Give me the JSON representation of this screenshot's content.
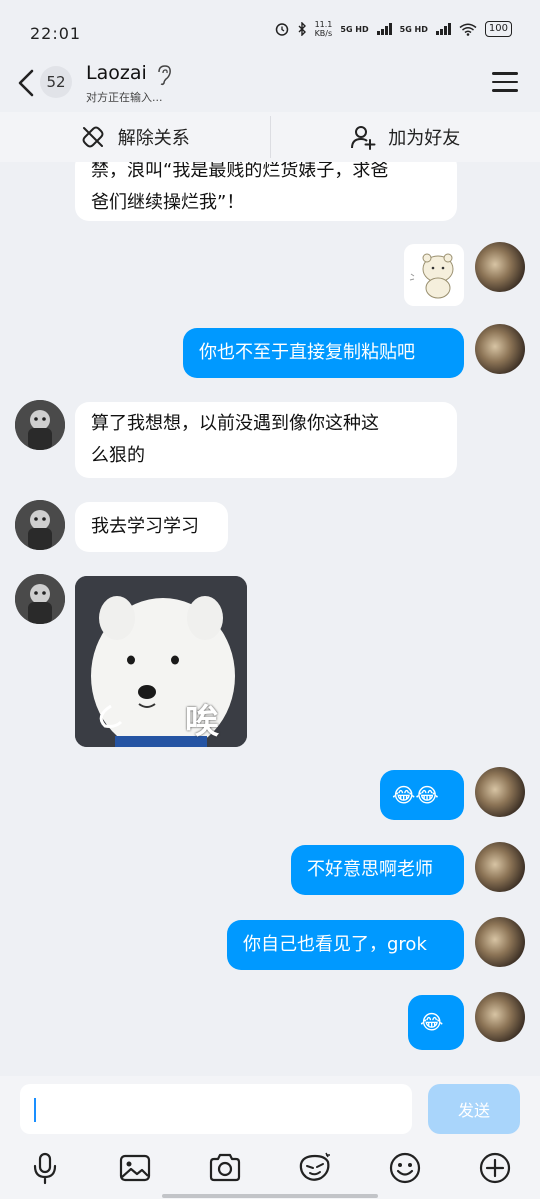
{
  "status_bar": {
    "time": "22:01",
    "net_speed_value": "11.1",
    "net_speed_unit": "KB/s",
    "sim1": "5G HD",
    "sim2": "5G HD",
    "battery": "100"
  },
  "header": {
    "unread_count": "52",
    "contact_name": "Laozai",
    "status_text": "对方正在输入..."
  },
  "actions": {
    "remove": "解除关系",
    "add": "加为好友"
  },
  "messages": [
    {
      "side": "other",
      "type": "text",
      "lines": [
        "禁，浪叫“我是最贱的烂货婊子，求爸",
        "爸们继续操烂我”！"
      ]
    },
    {
      "side": "me",
      "type": "sticker",
      "icon": "bear-sticker"
    },
    {
      "side": "me",
      "type": "text",
      "text": "你也不至于直接复制粘贴吧"
    },
    {
      "side": "other",
      "type": "text",
      "lines": [
        "算了我想想，以前没遇到像你这种这",
        "么狠的"
      ]
    },
    {
      "side": "other",
      "type": "text",
      "text": "我去学习学习"
    },
    {
      "side": "other",
      "type": "image",
      "caption": "唉",
      "icon": "samoyed-dog-image"
    },
    {
      "side": "me",
      "type": "text",
      "text": "😂😂"
    },
    {
      "side": "me",
      "type": "text",
      "text": "不好意思啊老师"
    },
    {
      "side": "me",
      "type": "text",
      "text": "你自己也看见了，grok"
    },
    {
      "side": "me",
      "type": "text",
      "text": "😂"
    }
  ],
  "input": {
    "value": "",
    "send_label": "发送"
  },
  "toolbar": [
    "microphone-icon",
    "image-icon",
    "camera-icon",
    "red-packet-icon",
    "emoji-icon",
    "plus-icon"
  ],
  "colors": {
    "accent_blue": "#0099ff",
    "send_disabled": "#a9d5fb",
    "background": "#eef0f4"
  }
}
